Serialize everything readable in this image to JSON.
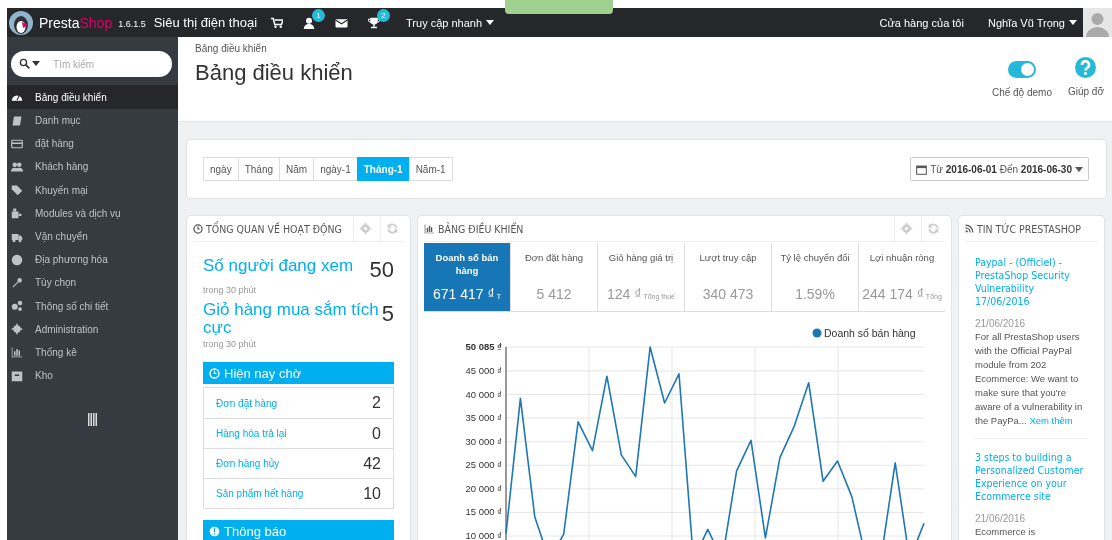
{
  "topbar": {
    "brand": {
      "first": "Presta",
      "second": "Shop"
    },
    "version": "1.6.1.5",
    "shop_name": "Siêu thị điện thoại",
    "badges": [
      "1",
      "2"
    ],
    "quick_access": "Truy cập nhanh",
    "my_shop": "Cửa hàng của tôi",
    "user_name": "Nghĩa Vũ Trọng"
  },
  "sidebar": {
    "search": {
      "placeholder": "Tìm kiếm"
    },
    "items": [
      {
        "label": "Bảng điều khiển",
        "selected": true
      },
      {
        "label": "Danh mục",
        "selected": false
      },
      {
        "label": "đặt hàng",
        "selected": false
      },
      {
        "label": "Khách hàng",
        "selected": false
      },
      {
        "label": "Khuyến mại",
        "selected": false
      },
      {
        "label": "Modules và dịch vụ",
        "selected": false
      },
      {
        "label": "Vận chuyển",
        "selected": false
      },
      {
        "label": "Địa phương hóa",
        "selected": false
      },
      {
        "label": "Tùy chọn",
        "selected": false
      },
      {
        "label": "Thông số chi tiết",
        "selected": false
      },
      {
        "label": "Administration",
        "selected": false
      },
      {
        "label": "Thống kê",
        "selected": false
      },
      {
        "label": "Kho",
        "selected": false
      }
    ]
  },
  "header": {
    "breadcrumb": "Bảng điều khiển",
    "title": "Bảng điều khiển",
    "demo_mode": {
      "label": "Chế độ demo",
      "on": true
    },
    "help": "Giúp đỡ"
  },
  "period_tabs": [
    {
      "label": "ngày",
      "selected": false
    },
    {
      "label": "Tháng",
      "selected": false
    },
    {
      "label": "Năm",
      "selected": false
    },
    {
      "label": "ngày-1",
      "selected": false
    },
    {
      "label": "Tháng-1",
      "selected": true
    },
    {
      "label": "Năm-1",
      "selected": false
    }
  ],
  "date_range": "Từ **2016-06-01** Đến **2016-06-30**",
  "activity": {
    "title": "TỔNG QUAN VỀ HOẠT ĐỘNG",
    "stats": [
      {
        "label": "Số người đang xem",
        "value": "50",
        "note": "trong 30 phút"
      },
      {
        "label": "Giỏ hàng mua sắm tích cực",
        "value": "5",
        "note": "trong 30 phút"
      }
    ],
    "pending_title": "Hiện nay chờ",
    "pending": [
      {
        "label": "Đơn đặt hàng",
        "value": "2"
      },
      {
        "label": "Hàng hóa trả lại",
        "value": "0"
      },
      {
        "label": "Đơn hàng hủy",
        "value": "42"
      },
      {
        "label": "Sản phẩm hết hàng",
        "value": "10"
      }
    ],
    "notice_title": "Thông báo"
  },
  "dashboard": {
    "title": "BẢNG ĐIỀU KHIỂN",
    "kpis": [
      {
        "label": "Doanh số bán hàng",
        "value": "671 417 ₫",
        "suffix": "T",
        "selected": true
      },
      {
        "label": "Đơn đặt hàng",
        "value": "5 412",
        "selected": false
      },
      {
        "label": "Giỏ hàng giá trị",
        "value": "124 ₫",
        "suffix": "Tổng thuế",
        "selected": false
      },
      {
        "label": "Lượt truy cập",
        "value": "340 473",
        "selected": false
      },
      {
        "label": "Tỷ lệ chuyển đổi",
        "value": "1.59%",
        "selected": false
      },
      {
        "label": "Lợi nhuận ròng",
        "value": "244 174 ₫",
        "suffix": "Tổng",
        "selected": false
      }
    ],
    "chart_data": {
      "type": "line",
      "series": [
        {
          "name": "Doanh số bán hàng",
          "color": "#1f77b4",
          "values": [
            10500,
            39200,
            14000,
            5000,
            10400,
            34200,
            28100,
            43900,
            27200,
            22600,
            50085,
            38200,
            44400,
            5000,
            11400,
            5000,
            23800,
            30300,
            9600,
            26600,
            33300,
            42500,
            21600,
            25900,
            18300,
            5000,
            5000,
            25500,
            5000,
            12700
          ]
        }
      ],
      "ylim": [
        0,
        50085
      ],
      "grid": true,
      "yticks": [
        {
          "value": 10000,
          "label": "10 000 ₫"
        },
        {
          "value": 15000,
          "label": "15 000 ₫"
        },
        {
          "value": 20000,
          "label": "20 000 ₫"
        },
        {
          "value": 25000,
          "label": "25 000 ₫"
        },
        {
          "value": 30000,
          "label": "30 000 ₫"
        },
        {
          "value": 35000,
          "label": "35 000 ₫"
        },
        {
          "value": 40000,
          "label": "40 000 ₫"
        },
        {
          "value": 45000,
          "label": "45 000 ₫"
        },
        {
          "value": 50085,
          "label": "50 085 ₫"
        }
      ]
    }
  },
  "news": {
    "title": "TIN TỨC PRESTASHOP",
    "items": [
      {
        "title": "Paypal - (Officiel) - PrestaShop Security Vulnerability 17/06/2016",
        "date": "21/06/2016",
        "body": "For all PrestaShop users with the Official PayPal module from 202 Ecommerce: We want to make sure that you're aware of a vulnerability in the PayPa...",
        "more": "Xem thêm"
      },
      {
        "title": "3 steps to building a Personalized Customer Experience on your Ecommerce site",
        "date": "21/06/2016",
        "body": "Ecommerce is"
      }
    ]
  }
}
